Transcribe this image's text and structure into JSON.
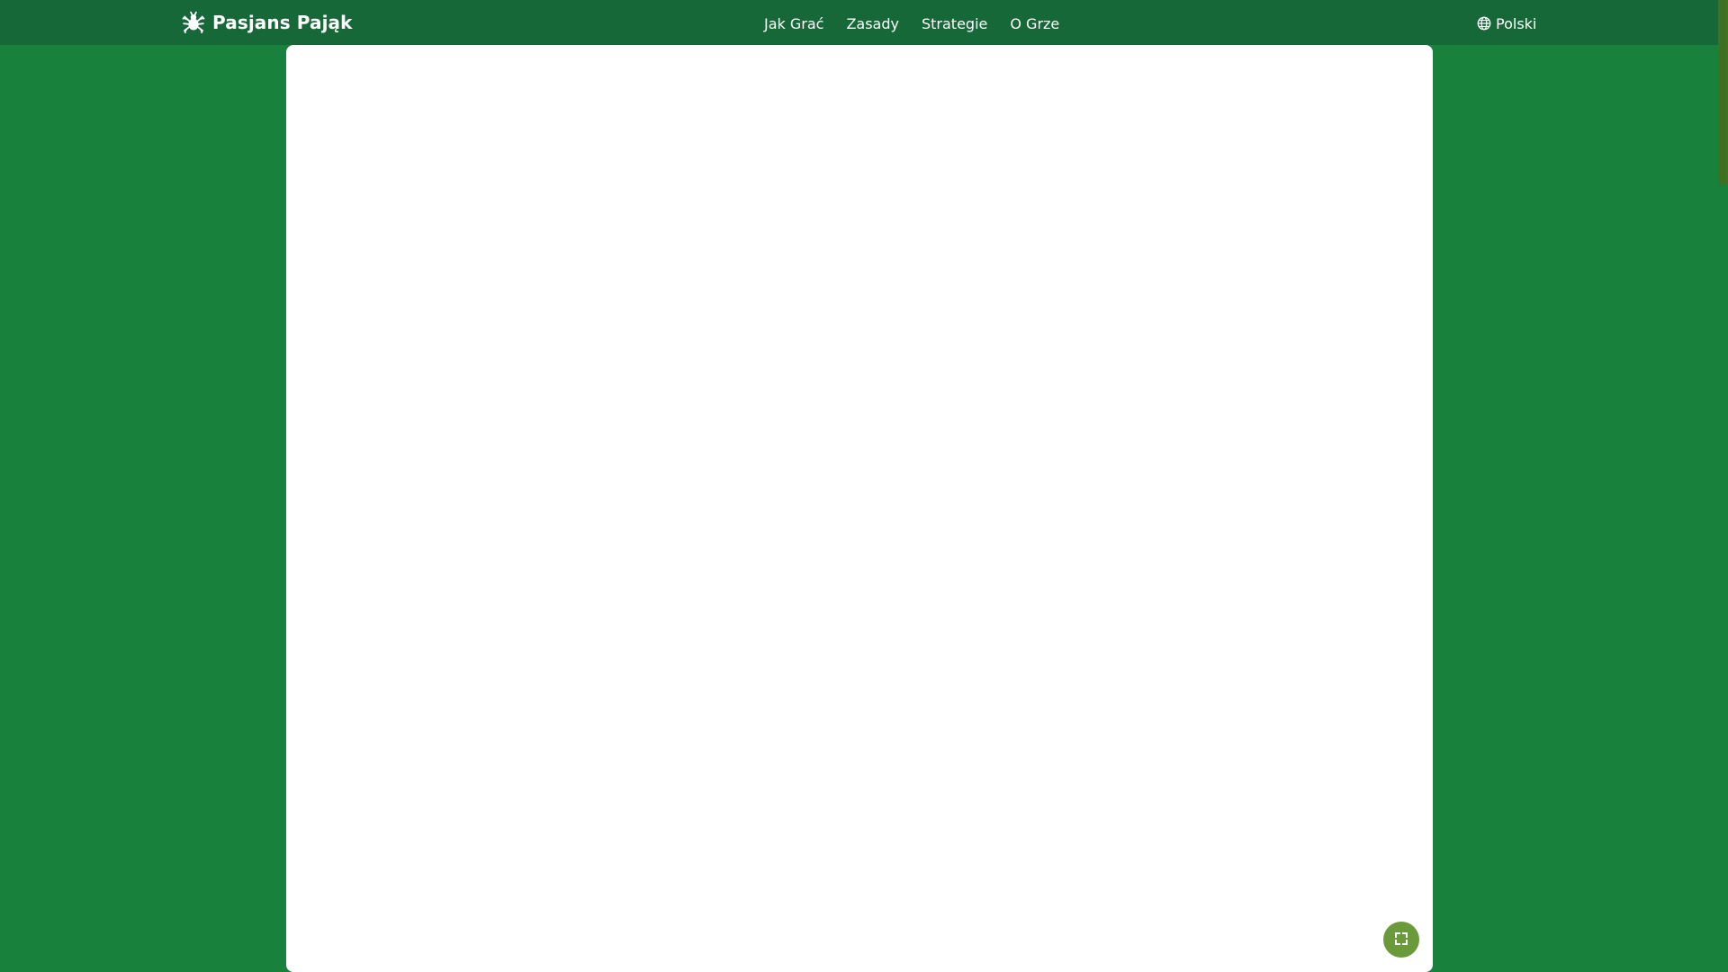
{
  "header": {
    "brand_icon": "spider-icon",
    "brand_title": "Pasjans Pająk",
    "nav": [
      {
        "label": "Jak Grać"
      },
      {
        "label": "Zasady"
      },
      {
        "label": "Strategie"
      },
      {
        "label": "O Grze"
      }
    ],
    "language_icon": "globe-icon",
    "language_label": "Polski"
  },
  "game": {
    "fullscreen_icon": "fullscreen-icon"
  },
  "colors": {
    "page_background": "#18823d",
    "header_background": "#176838",
    "panel_background": "#ffffff",
    "fullscreen_button": "#6a9a3a",
    "scroll_thumb": "#3f6f23"
  }
}
